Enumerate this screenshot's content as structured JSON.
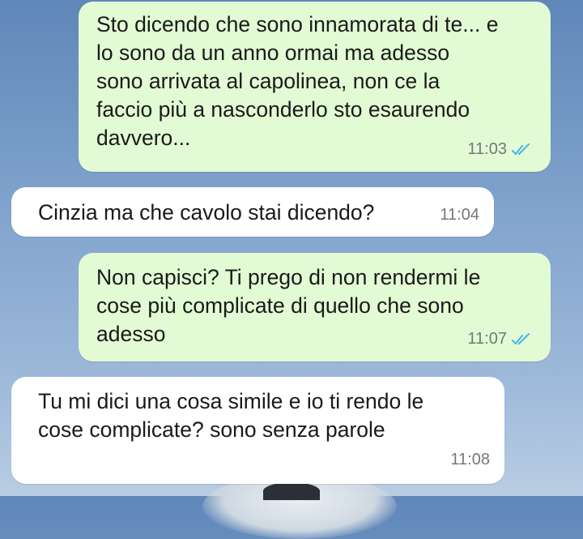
{
  "messages": [
    {
      "direction": "out",
      "lines": [
        "Sto dicendo che sono innamorata di te... e",
        "lo sono da un anno ormai ma adesso",
        "sono arrivata al capolinea, non ce la",
        "faccio più a nasconderlo sto esaurendo",
        "davvero..."
      ],
      "time": "11:03",
      "status": "read"
    },
    {
      "direction": "in",
      "lines": [
        "Cinzia ma che cavolo stai dicendo?"
      ],
      "time": "11:04"
    },
    {
      "direction": "out",
      "lines": [
        "Non capisci? Ti prego di non rendermi le",
        "cose più complicate di quello che sono",
        "adesso"
      ],
      "time": "11:07",
      "status": "read"
    },
    {
      "direction": "in",
      "lines": [
        "Tu mi dici una cosa simile e io ti rendo le",
        "cose complicate? sono senza parole"
      ],
      "time": "11:08"
    }
  ],
  "colors": {
    "outgoing_bubble": "#e2fbd4",
    "incoming_bubble": "#ffffff",
    "read_ticks": "#4fb6ec",
    "wallpaper": "#7fa2cc"
  },
  "icons": {
    "read_status": "double-check-icon"
  }
}
